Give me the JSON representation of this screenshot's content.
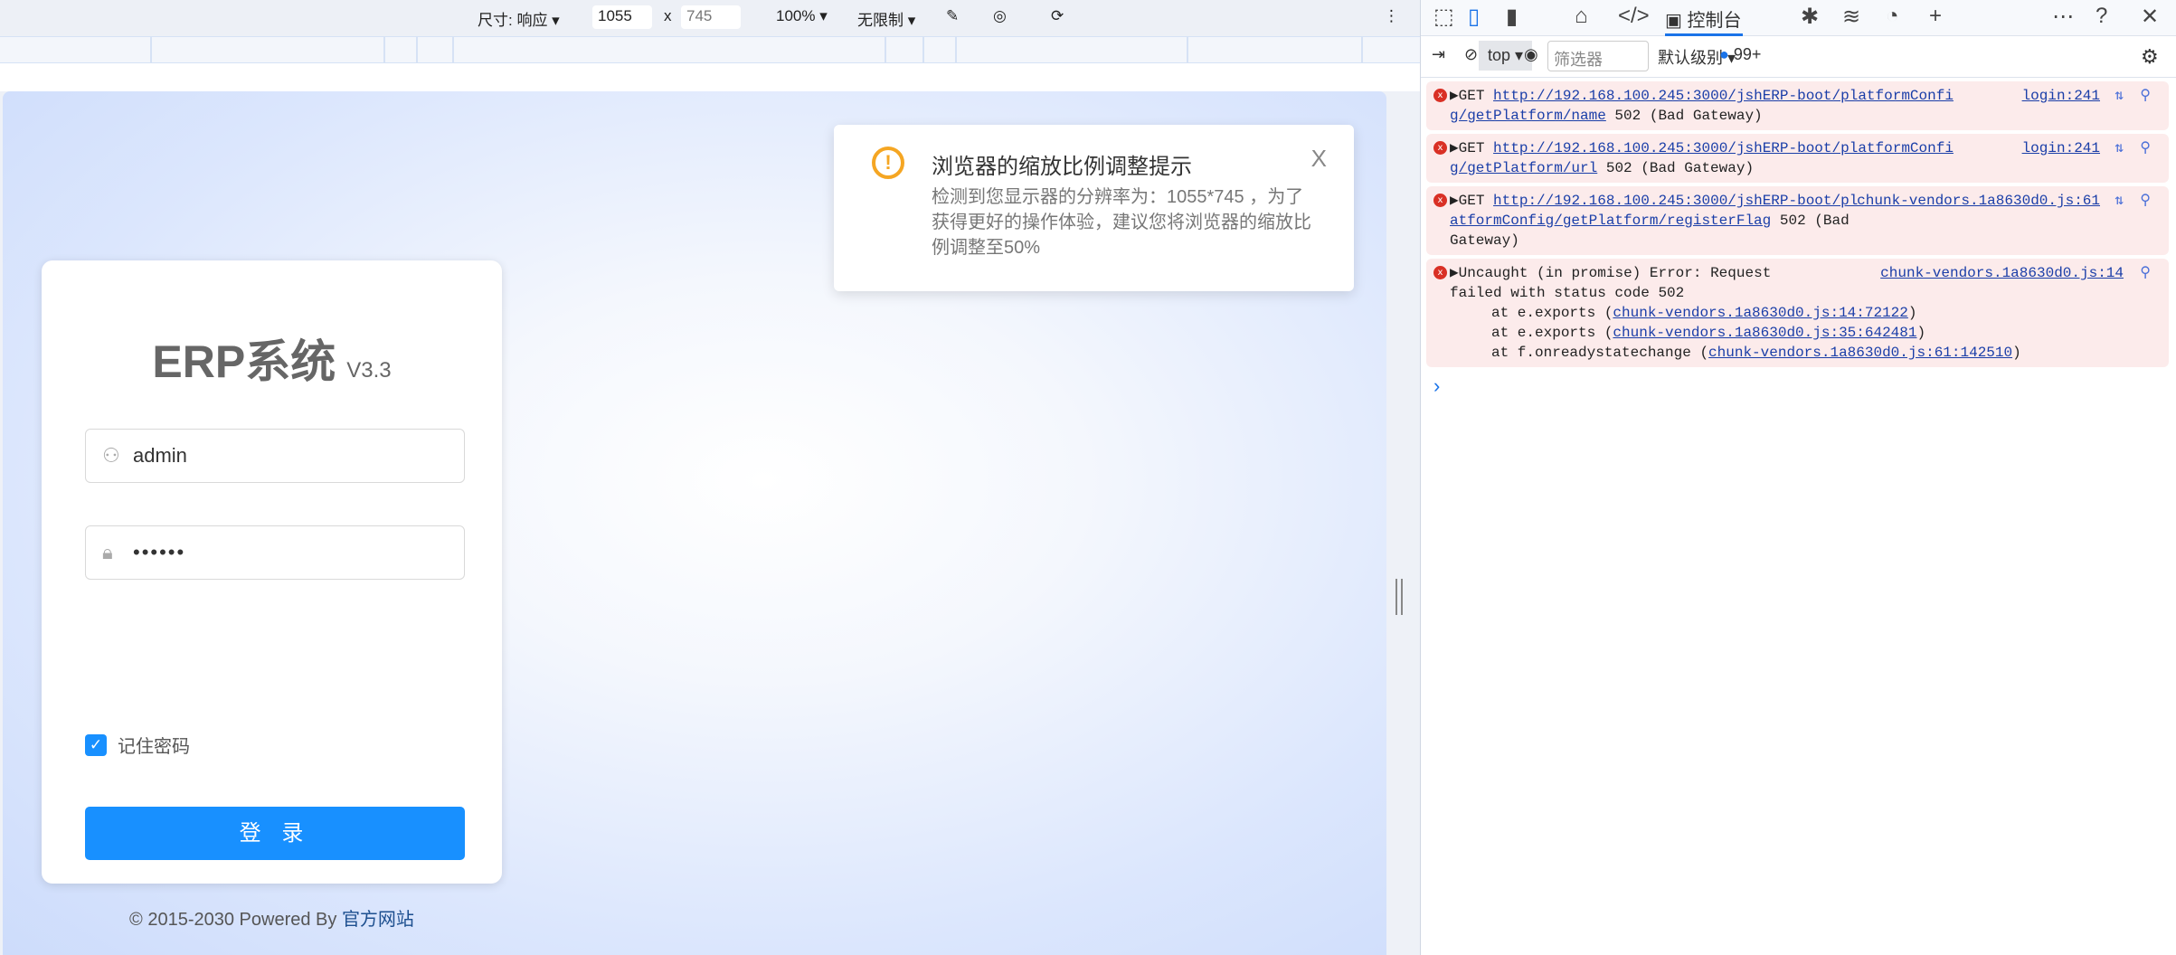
{
  "device_toolbar": {
    "size_label": "尺寸: 响应",
    "width": "1055",
    "x": "x",
    "height": "745",
    "zoom": "100%",
    "throttle": "无限制"
  },
  "notice": {
    "title": "浏览器的缩放比例调整提示",
    "body": "检测到您显示器的分辨率为：1055*745 ，为了获得更好的操作体验，建议您将浏览器的缩放比例调整至50%",
    "close": "X"
  },
  "login": {
    "title": "ERP系统",
    "version": "V3.3",
    "username": "admin",
    "password": "••••••",
    "remember": "记住密码",
    "remember_checked": true,
    "submit": "登 录",
    "footer": "© 2015-2030 Powered By ",
    "footer_link": "官方网站",
    "accent": "#1890ff"
  },
  "devtools": {
    "console_tab": "控制台",
    "context": "top",
    "filter_placeholder": "筛选器",
    "level": "默认级别",
    "count": "99+",
    "messages": [
      {
        "prefix": "▶GET ",
        "url": "http://192.168.100.245:3000/jshERP-boot/platformConfig/getPlatform/name",
        "suffix": " 502 (Bad Gateway)",
        "source": "login:241"
      },
      {
        "prefix": "▶GET ",
        "url": "http://192.168.100.245:3000/jshERP-boot/platformConfig/getPlatform/url",
        "suffix": " 502 (Bad Gateway)",
        "source": "login:241"
      },
      {
        "prefix": "▶GET ",
        "url": "http://192.168.100.245:3000/jshERP-boot/platformConfig/getPlatform/registerFlag",
        "suffix": " 502 (Bad Gateway)",
        "source": "chunk-vendors.1a8630d0.js:61"
      },
      {
        "text": "▶Uncaught (in promise) Error: Request failed with status code 502",
        "source": "chunk-vendors.1a8630d0.js:14",
        "stack": [
          {
            "at": "at e.exports (",
            "link": "chunk-vendors.1a8630d0.js:14:72122"
          },
          {
            "at": "at e.exports (",
            "link": "chunk-vendors.1a8630d0.js:35:642481"
          },
          {
            "at": "at f.onreadystatechange (",
            "link": "chunk-vendors.1a8630d0.js:61:142510"
          }
        ]
      }
    ]
  }
}
